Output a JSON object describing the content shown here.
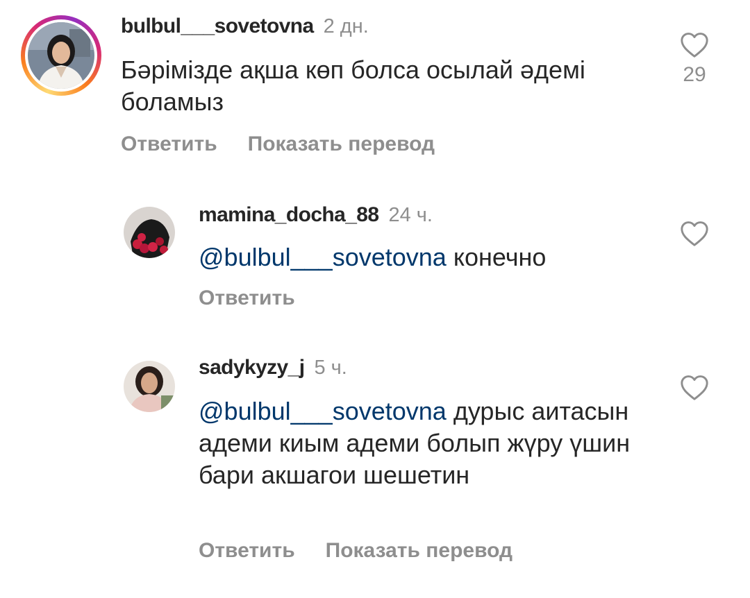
{
  "comments": [
    {
      "username": "bulbul___sovetovna",
      "time": "2 дн.",
      "text": "Бәрімізде ақша көп болса осылай әдемі боламыз",
      "reply_label": "Ответить",
      "translate_label": "Показать перевод",
      "likes": "29",
      "avatar": "avatar-woman-white-blazer",
      "has_story_ring": true
    },
    {
      "username": "mamina_docha_88",
      "time": "24 ч.",
      "mention": "@bulbul___sovetovna",
      "text": " конечно",
      "reply_label": "Ответить",
      "avatar": "avatar-roses-bouquet"
    },
    {
      "username": "sadykyzy_j",
      "time": "5 ч.",
      "mention": "@bulbul___sovetovna",
      "text": " дурыс аитасын адеми киым адеми болып жүру үшин бари акшагои шешетин",
      "reply_label": "Ответить",
      "translate_label": "Показать перевод",
      "avatar": "avatar-woman-dark-hair"
    }
  ],
  "colors": {
    "text": "#262626",
    "secondary": "#8e8e8e",
    "mention": "#00376b",
    "heart_outline": "#8e8e8e"
  },
  "icons": {
    "like": "heart-outline-icon"
  }
}
